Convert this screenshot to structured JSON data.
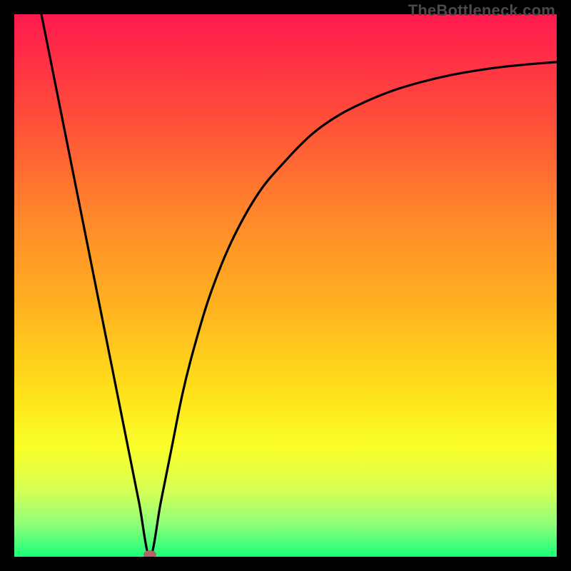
{
  "watermark": "TheBottleneck.com",
  "chart_data": {
    "type": "line",
    "title": "",
    "xlabel": "",
    "ylabel": "",
    "xlim": [
      0,
      100
    ],
    "ylim": [
      0,
      100
    ],
    "grid": false,
    "legend": false,
    "annotations": [],
    "background_gradient_stops": [
      {
        "offset": 0.0,
        "color": "#ff1a4f"
      },
      {
        "offset": 0.18,
        "color": "#ff4a3a"
      },
      {
        "offset": 0.38,
        "color": "#ff8a2a"
      },
      {
        "offset": 0.55,
        "color": "#ffb51f"
      },
      {
        "offset": 0.7,
        "color": "#ffe21a"
      },
      {
        "offset": 0.8,
        "color": "#f9ff2a"
      },
      {
        "offset": 0.88,
        "color": "#d4ff55"
      },
      {
        "offset": 0.94,
        "color": "#8fff7a"
      },
      {
        "offset": 1.0,
        "color": "#1aff7a"
      }
    ],
    "marker": {
      "x": 25,
      "y": 0,
      "color": "#b3666a",
      "rx": 9,
      "ry": 6
    },
    "series": [
      {
        "name": "curve",
        "color": "#000000",
        "x": [
          5,
          7,
          9,
          11,
          13,
          15,
          17,
          19,
          21,
          23,
          25,
          27,
          29,
          31,
          33,
          36,
          40,
          45,
          50,
          55,
          60,
          65,
          70,
          75,
          80,
          85,
          90,
          95,
          100
        ],
        "y": [
          100,
          90,
          80,
          70,
          60,
          50,
          40,
          30,
          20,
          10,
          0,
          10,
          20,
          30,
          38,
          48,
          58,
          67,
          73,
          78,
          81.5,
          84,
          86,
          87.5,
          88.7,
          89.6,
          90.3,
          90.8,
          91.2
        ]
      }
    ]
  }
}
